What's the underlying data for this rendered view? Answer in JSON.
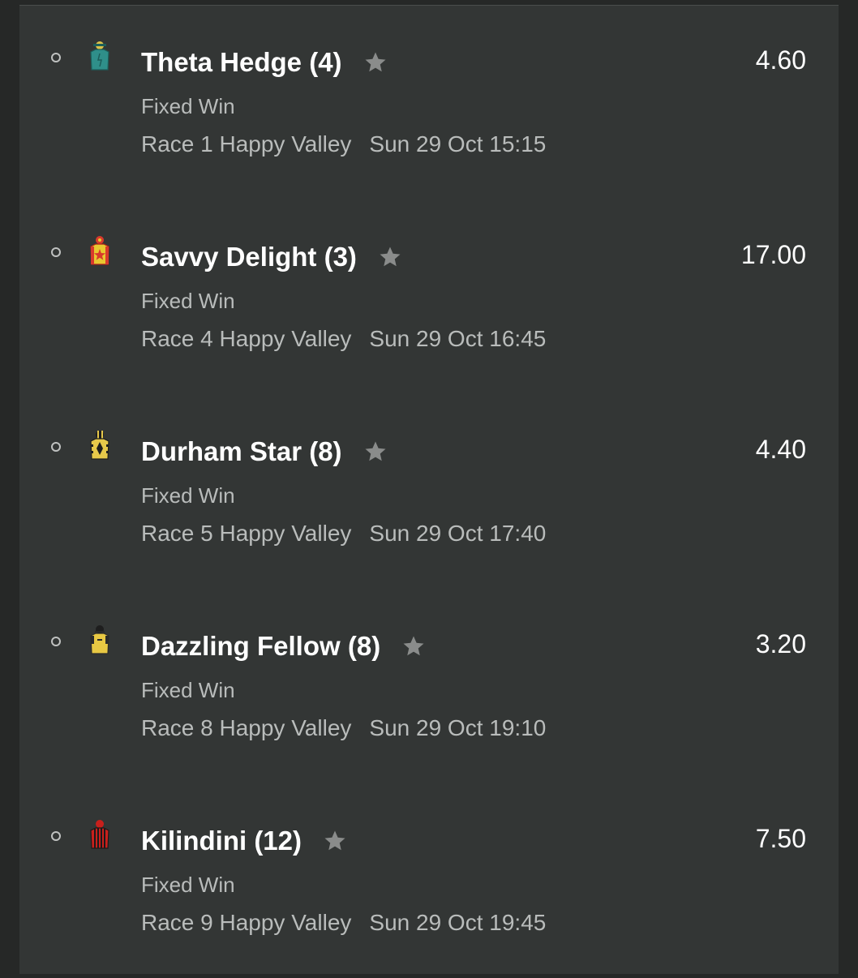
{
  "bets": [
    {
      "horse": "Theta Hedge (4)",
      "market": "Fixed Win",
      "race": "Race 1 Happy Valley",
      "when": "Sun 29 Oct 15:15",
      "odds": "4.60",
      "silk": "teal-silk-icon",
      "silk_colors": {
        "cap": "#d8c24a",
        "body": "#2f8f8a",
        "trim": "#1c5e5a"
      }
    },
    {
      "horse": "Savvy Delight (3)",
      "market": "Fixed Win",
      "race": "Race 4 Happy Valley",
      "when": "Sun 29 Oct 16:45",
      "odds": "17.00",
      "silk": "yellow-red-star-silk-icon",
      "silk_colors": {
        "cap": "#d83a2c",
        "body": "#e8c830",
        "trim": "#d83a2c"
      }
    },
    {
      "horse": "Durham Star (8)",
      "market": "Fixed Win",
      "race": "Race 5 Happy Valley",
      "when": "Sun 29 Oct 17:40",
      "odds": "4.40",
      "silk": "yellow-black-diamond-silk-icon",
      "silk_colors": {
        "cap": "#1e1e1e",
        "body": "#e6c84a",
        "trim": "#1e1e1e"
      }
    },
    {
      "horse": "Dazzling Fellow (8)",
      "market": "Fixed Win",
      "race": "Race 8 Happy Valley",
      "when": "Sun 29 Oct 19:10",
      "odds": "3.20",
      "silk": "yellow-black-silk-icon",
      "silk_colors": {
        "cap": "#1e1e1e",
        "body": "#e8c843",
        "trim": "#2a2a2a"
      }
    },
    {
      "horse": "Kilindini (12)",
      "market": "Fixed Win",
      "race": "Race 9 Happy Valley",
      "when": "Sun 29 Oct 19:45",
      "odds": "7.50",
      "silk": "red-black-stripes-silk-icon",
      "silk_colors": {
        "cap": "#c8201c",
        "body": "#c8201c",
        "trim": "#1a1a1a"
      }
    }
  ],
  "colors": {
    "background": "#262827",
    "panel": "#333635",
    "primary_text": "#ffffff",
    "secondary_text": "#b9bcbb",
    "star": "#8a8c8b"
  }
}
